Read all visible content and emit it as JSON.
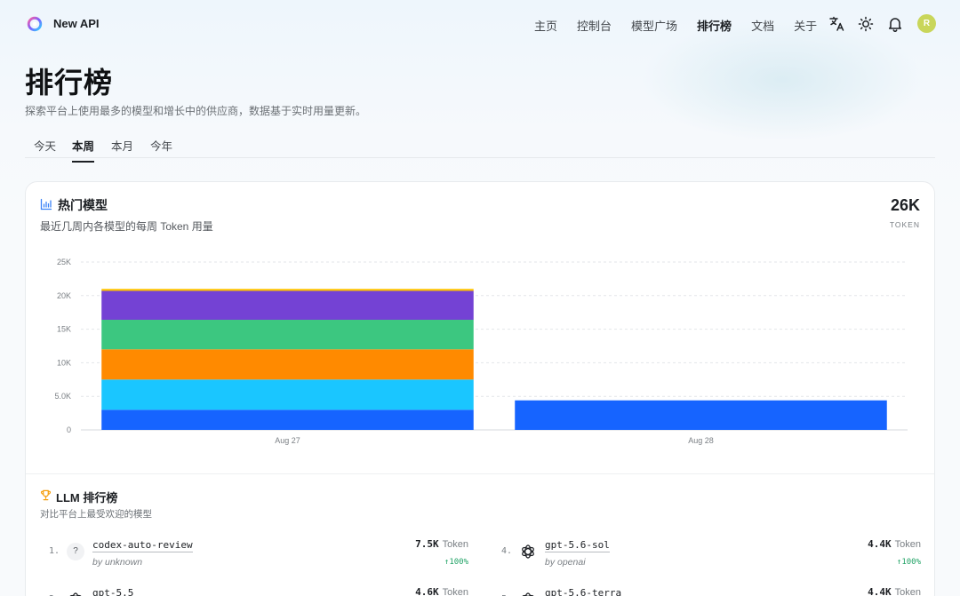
{
  "header": {
    "brand": "New API",
    "nav": [
      "主页",
      "控制台",
      "模型广场",
      "排行榜",
      "文档",
      "关于"
    ],
    "active_nav": "排行榜",
    "avatar_letter": "R"
  },
  "page": {
    "title": "排行榜",
    "subtitle": "探索平台上使用最多的模型和增长中的供应商，数据基于实时用量更新。",
    "tabs": [
      "今天",
      "本周",
      "本月",
      "今年"
    ],
    "active_tab": "本周"
  },
  "hot_models": {
    "title": "热门模型",
    "subtitle": "最近几周内各模型的每周 Token 用量",
    "total_value": "26K",
    "total_unit": "TOKEN"
  },
  "chart_data": {
    "type": "bar",
    "stacked": true,
    "categories": [
      "Aug 27",
      "Aug 28"
    ],
    "series": [
      {
        "color": "#1664ff",
        "values": [
          3000,
          4400
        ]
      },
      {
        "color": "#1ac6ff",
        "values": [
          4500,
          0
        ]
      },
      {
        "color": "#ff8a00",
        "values": [
          4500,
          0
        ]
      },
      {
        "color": "#3cc780",
        "values": [
          4400,
          0
        ]
      },
      {
        "color": "#7442d4",
        "values": [
          4300,
          0
        ]
      },
      {
        "color": "#ffc400",
        "values": [
          300,
          0
        ]
      }
    ],
    "ylim": [
      0,
      25000
    ],
    "yticks": [
      "0",
      "5.0K",
      "10K",
      "15K",
      "20K",
      "25K"
    ],
    "grid": true
  },
  "llm": {
    "title": "LLM 排行榜",
    "subtitle": "对比平台上最受欢迎的模型",
    "token_label": "Token",
    "rows": [
      {
        "rank": "1.",
        "name": "codex-auto-review",
        "by": "by unknown",
        "value": "7.5K",
        "change": "↑100%",
        "icon": "unknown-icon",
        "icon_char": "?"
      },
      {
        "rank": "4.",
        "name": "gpt-5.6-sol",
        "by": "by openai",
        "value": "4.4K",
        "change": "↑100%",
        "icon": "openai-icon"
      },
      {
        "rank": "2.",
        "name": "gpt-5.5",
        "by": "",
        "value": "4.6K",
        "change": "",
        "icon": "openai-icon"
      },
      {
        "rank": "5.",
        "name": "gpt-5.6-terra",
        "by": "",
        "value": "4.4K",
        "change": "",
        "icon": "openai-icon"
      }
    ]
  }
}
